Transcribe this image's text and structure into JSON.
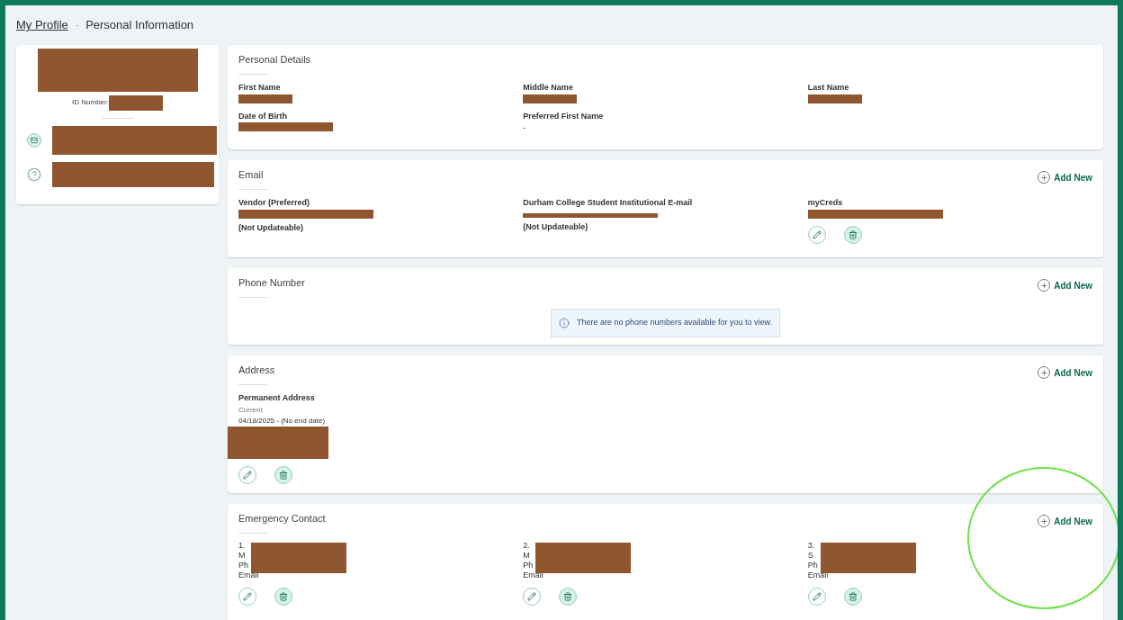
{
  "breadcrumb": {
    "link": "My Profile",
    "separator": "-",
    "current": "Personal Information"
  },
  "profile_card": {
    "id_label": "ID Number:"
  },
  "sections": [
    {
      "kind": "details",
      "title": "Personal Details",
      "fields": [
        {
          "label": "First Name"
        },
        {
          "label": "Middle Name"
        },
        {
          "label": "Last Name"
        },
        {
          "label": "Date of Birth"
        },
        {
          "label": "Preferred First Name",
          "value": "-"
        }
      ]
    },
    {
      "kind": "list",
      "title": "Email",
      "add_label": "Add New",
      "items": [
        {
          "label": "Vendor (Preferred)",
          "note": "(Not Updateable)",
          "editable": false
        },
        {
          "label": "Durham College Student Institutional E-mail",
          "note": "(Not Updateable)",
          "editable": false
        },
        {
          "label": "myCreds",
          "editable": true
        }
      ]
    },
    {
      "kind": "empty",
      "title": "Phone Number",
      "add_label": "Add New",
      "message": "There are no phone numbers available for you to view."
    },
    {
      "kind": "address",
      "title": "Address",
      "add_label": "Add New",
      "address_type": "Permanent Address",
      "status": "Current",
      "dates": "04/18/2025 - (No end date)"
    },
    {
      "kind": "contacts",
      "title": "Emergency Contact",
      "add_label": "Add New",
      "contacts": [
        {
          "lines": [
            "1.",
            "M",
            "Ph",
            "Email"
          ]
        },
        {
          "lines": [
            "2.",
            "M",
            "Ph",
            "Email"
          ]
        },
        {
          "lines": [
            "3.",
            "S",
            "Ph",
            "Email"
          ]
        }
      ]
    }
  ]
}
